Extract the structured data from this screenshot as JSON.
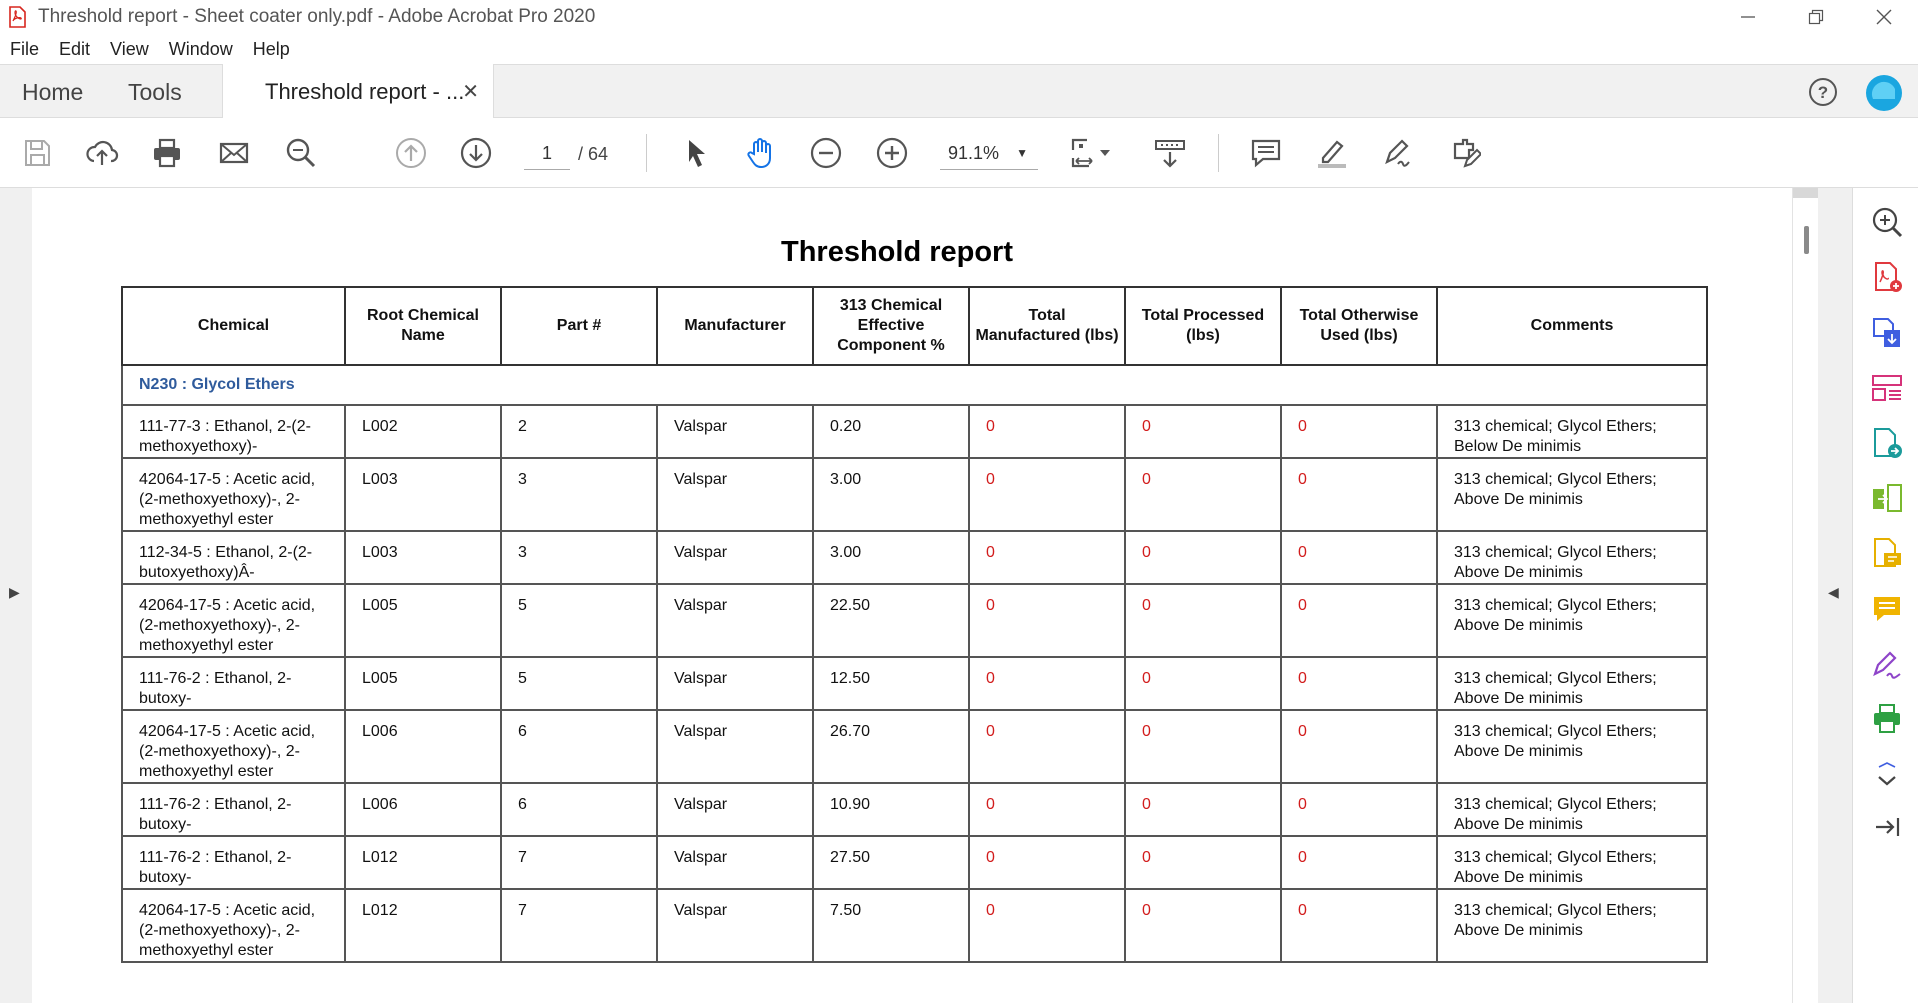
{
  "window": {
    "title": "Threshold report - Sheet coater only.pdf - Adobe Acrobat Pro 2020"
  },
  "menu": [
    "File",
    "Edit",
    "View",
    "Window",
    "Help"
  ],
  "tabs": {
    "home": "Home",
    "tools": "Tools",
    "document": "Threshold report - ..."
  },
  "toolbar": {
    "page_current": "1",
    "page_total": "/  64",
    "zoom": "91.1%"
  },
  "report": {
    "title": "Threshold report",
    "headers": [
      "Chemical",
      "Root Chemical Name",
      "Part #",
      "Manufacturer",
      "313 Chemical Effective Component %",
      "Total Manufactured (lbs)",
      "Total Processed (lbs)",
      "Total Otherwise Used (lbs)",
      "Comments"
    ],
    "group": "N230 : Glycol Ethers",
    "rows": [
      [
        "111-77-3 : Ethanol, 2-(2-methoxyethoxy)-",
        "L002",
        "2",
        "Valspar",
        "0.20",
        "0",
        "0",
        "0",
        "313 chemical; Glycol Ethers; Below De minimis"
      ],
      [
        "42064-17-5 : Acetic acid, (2-methoxyethoxy)-, 2-methoxyethyl ester",
        "L003",
        "3",
        "Valspar",
        "3.00",
        "0",
        "0",
        "0",
        "313 chemical; Glycol Ethers; Above De minimis"
      ],
      [
        "112-34-5 : Ethanol, 2-(2-butoxyethoxy)Â-",
        "L003",
        "3",
        "Valspar",
        "3.00",
        "0",
        "0",
        "0",
        "313 chemical; Glycol Ethers; Above De minimis"
      ],
      [
        "42064-17-5 : Acetic acid, (2-methoxyethoxy)-, 2-methoxyethyl ester",
        "L005",
        "5",
        "Valspar",
        "22.50",
        "0",
        "0",
        "0",
        "313 chemical; Glycol Ethers; Above De minimis"
      ],
      [
        "111-76-2 : Ethanol, 2-butoxy-",
        "L005",
        "5",
        "Valspar",
        "12.50",
        "0",
        "0",
        "0",
        "313 chemical; Glycol Ethers; Above De minimis"
      ],
      [
        "42064-17-5 : Acetic acid, (2-methoxyethoxy)-, 2-methoxyethyl ester",
        "L006",
        "6",
        "Valspar",
        "26.70",
        "0",
        "0",
        "0",
        "313 chemical; Glycol Ethers; Above De minimis"
      ],
      [
        "111-76-2 : Ethanol, 2-butoxy-",
        "L006",
        "6",
        "Valspar",
        "10.90",
        "0",
        "0",
        "0",
        "313 chemical; Glycol Ethers; Above De minimis"
      ],
      [
        "111-76-2 : Ethanol, 2-butoxy-",
        "L012",
        "7",
        "Valspar",
        "27.50",
        "0",
        "0",
        "0",
        "313 chemical; Glycol Ethers; Above De minimis"
      ],
      [
        "42064-17-5 : Acetic acid, (2-methoxyethoxy)-, 2-methoxyethyl ester",
        "L012",
        "7",
        "Valspar",
        "7.50",
        "0",
        "0",
        "0",
        "313 chemical; Glycol Ethers; Above De minimis"
      ]
    ]
  },
  "icons": {
    "toolbar": [
      "save-icon",
      "upload-icon",
      "print-icon",
      "email-icon",
      "search-icon",
      "page-up-icon",
      "page-down-icon",
      "select-cursor-icon",
      "hand-icon",
      "zoom-out-icon",
      "zoom-in-icon",
      "fit-page-icon",
      "scroll-mode-icon",
      "comment-icon",
      "highlight-icon",
      "sign-icon",
      "edit-pdf-icon"
    ],
    "right_panel": [
      "zoom-panel-icon",
      "create-pdf-icon",
      "export-pdf-icon",
      "organize-pages-icon",
      "send-for-review-icon",
      "combine-files-icon",
      "fill-sign-icon",
      "comment-tool-icon",
      "sign-tool-icon",
      "print-production-icon",
      "more-tools-icon",
      "collapse-panel-icon"
    ]
  },
  "colors": {
    "group_text": "#2f5b9c",
    "zero_values": "#d21c1c",
    "accent": "#1aa6e0"
  }
}
